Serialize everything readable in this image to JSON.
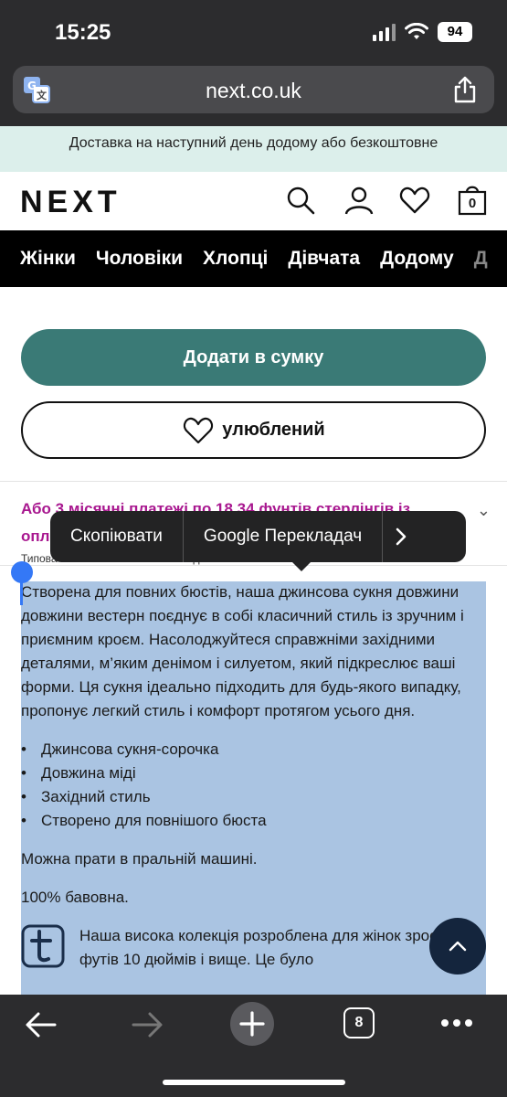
{
  "status_bar": {
    "time": "15:25",
    "battery": "94"
  },
  "browser": {
    "url": "next.co.uk",
    "tab_count": "8"
  },
  "banner": {
    "text": "Доставка на наступний день додому або безкоштовне"
  },
  "header": {
    "logo": "NEXT",
    "bag_count": "0"
  },
  "nav": {
    "items": [
      "Жінки",
      "Чоловіки",
      "Хлопці",
      "Дівчата",
      "Додому",
      "Д"
    ]
  },
  "product": {
    "add_to_bag": "Додати в сумку",
    "favourite": "улюблений",
    "payment_line1": "Або 3 місячні платежі по 18,34 фунтів стерлінгів із",
    "payment_line2": "опл",
    "legal": "Типова змінна 25.9% APR. Необхідна ставка 25.9% в рік змінна."
  },
  "context_menu": {
    "copy": "Скопіювати",
    "translate": "Google Перекладач"
  },
  "description": {
    "intro": "Створена для повних бюстів, наша джинсова сукня довжини довжини вестерн поєднує в собі класичний стиль із зручним і приємним кроєм. Насолоджуйтеся справжніми західними деталями, м’яким денімом і силуетом, який підкреслює ваші форми. Ця сукня ідеально підходить для будь-якого випадку, пропонує легкий стиль і комфорт протягом усього дня.",
    "bullets": [
      "Джинсова сукня-сорочка",
      "Довжина міді",
      "Західний стиль",
      "Створено для повнішого бюста"
    ],
    "care": "Можна прати в пральній машині.",
    "material": "100% бавовна.",
    "tall_text": "Наша висока колекція розроблена для жінок зростом 5 футів 10 дюймів і вище. Це було"
  },
  "colors": {
    "accent": "#3a7a76",
    "payment": "#a8178f",
    "selection": "#aac4e2",
    "nav_bg": "#000000",
    "banner_bg": "#dcefeb"
  }
}
